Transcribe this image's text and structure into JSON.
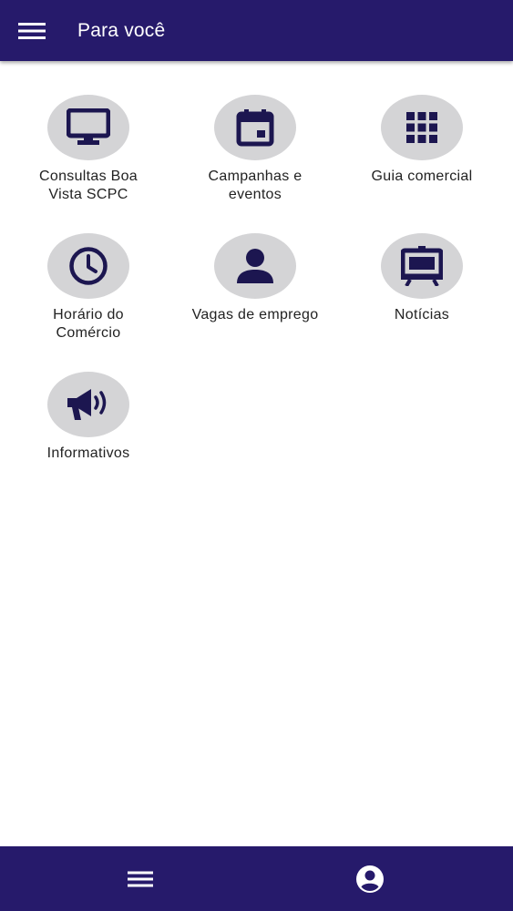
{
  "header": {
    "title": "Para você",
    "menu_icon": "hamburger-menu-icon"
  },
  "tiles": [
    {
      "label": "Consultas Boa\nVista SCPC",
      "icon": "monitor-icon"
    },
    {
      "label": "Campanhas e\neventos",
      "icon": "calendar-icon"
    },
    {
      "label": "Guia comercial",
      "icon": "grid-icon"
    },
    {
      "label": "Horário do\nComércio",
      "icon": "clock-icon"
    },
    {
      "label": "Vagas de emprego",
      "icon": "person-icon"
    },
    {
      "label": "Notícias",
      "icon": "presentation-board-icon"
    },
    {
      "label": "Informativos",
      "icon": "megaphone-icon"
    }
  ],
  "bottom_nav": {
    "menu_icon": "hamburger-menu-icon",
    "account_icon": "account-circle-icon"
  },
  "colors": {
    "bar": "#261a6b",
    "icon": "#1c1650",
    "circle": "#d4d4d6"
  }
}
